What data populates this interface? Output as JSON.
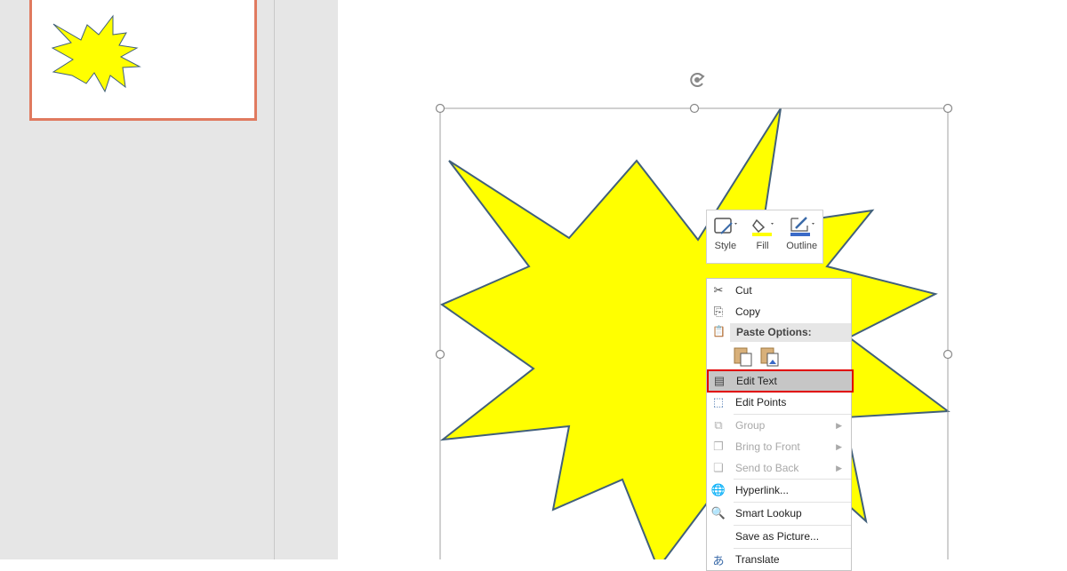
{
  "mini_toolbar": {
    "style": "Style",
    "fill": "Fill",
    "outline": "Outline"
  },
  "context_menu": {
    "cut": "Cut",
    "copy": "Copy",
    "paste_options": "Paste Options:",
    "edit_text": "Edit Text",
    "edit_points": "Edit Points",
    "group": "Group",
    "bring_to_front": "Bring to Front",
    "send_to_back": "Send to Back",
    "hyperlink": "Hyperlink...",
    "smart_lookup": "Smart Lookup",
    "save_as_picture": "Save as Picture...",
    "translate": "Translate"
  },
  "colors": {
    "shape_fill": "#ffff00",
    "shape_stroke": "#41607a",
    "thumb_border": "#e07a5f",
    "highlight_border": "#e00000"
  }
}
